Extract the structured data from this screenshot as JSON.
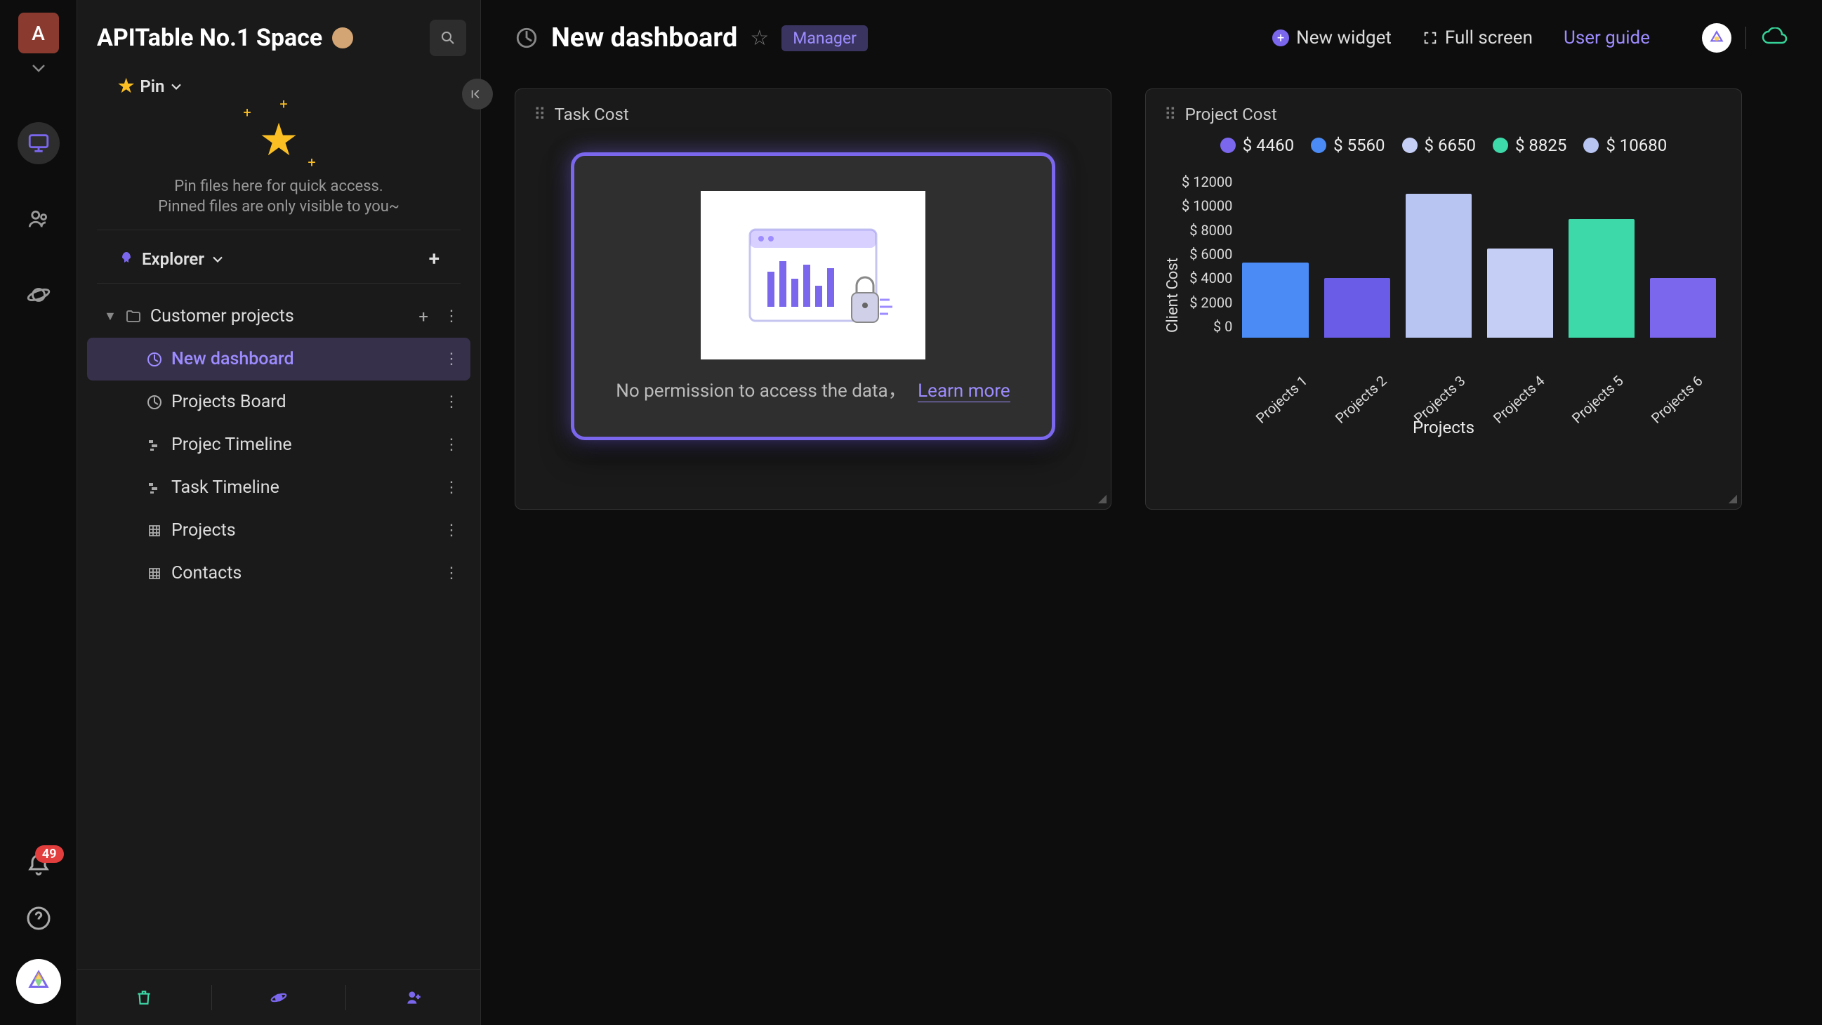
{
  "rail": {
    "avatar_letter": "A",
    "notification_count": "49"
  },
  "sidebar": {
    "space_title": "APITable No.1 Space",
    "pin": {
      "label": "Pin",
      "line1": "Pin files here for quick access.",
      "line2": "Pinned files are only visible to you~"
    },
    "explorer_label": "Explorer",
    "folder": {
      "name": "Customer projects",
      "items": [
        {
          "label": "New dashboard",
          "icon": "dashboard"
        },
        {
          "label": "Projects Board",
          "icon": "dashboard"
        },
        {
          "label": "Projec Timeline",
          "icon": "gantt"
        },
        {
          "label": "Task Timeline",
          "icon": "gantt"
        },
        {
          "label": "Projects",
          "icon": "grid"
        },
        {
          "label": "Contacts",
          "icon": "grid"
        }
      ]
    }
  },
  "header": {
    "title": "New dashboard",
    "role": "Manager",
    "new_widget": "New widget",
    "full_screen": "Full screen",
    "user_guide": "User guide"
  },
  "widgets": {
    "task_cost": {
      "title": "Task Cost",
      "message": "No permission to access the data，",
      "learn_more": "Learn more"
    },
    "project_cost": {
      "title": "Project Cost"
    }
  },
  "chart_data": {
    "type": "bar",
    "title": "Project Cost",
    "xlabel": "Projects",
    "ylabel": "Client Cost",
    "ylim": [
      0,
      12000
    ],
    "y_ticks": [
      "$ 12000",
      "$ 10000",
      "$ 8000",
      "$ 6000",
      "$ 4000",
      "$ 2000",
      "$ 0"
    ],
    "categories": [
      "Projects 1",
      "Projects 2",
      "Projects 3",
      "Projects 4",
      "Projects 5",
      "Projects 6"
    ],
    "values": [
      5560,
      4460,
      10680,
      6650,
      8825,
      4460
    ],
    "colors": [
      "#4a8bf5",
      "#6b5ce7",
      "#b8c5f2",
      "#c5cef5",
      "#3dd9a8",
      "#7b67ee"
    ],
    "legend": [
      {
        "label": "$ 4460",
        "color": "#7b67ee"
      },
      {
        "label": "$ 5560",
        "color": "#4a8bf5"
      },
      {
        "label": "$ 6650",
        "color": "#c5cef5"
      },
      {
        "label": "$ 8825",
        "color": "#3dd9a8"
      },
      {
        "label": "$ 10680",
        "color": "#b8c5f2"
      }
    ]
  }
}
